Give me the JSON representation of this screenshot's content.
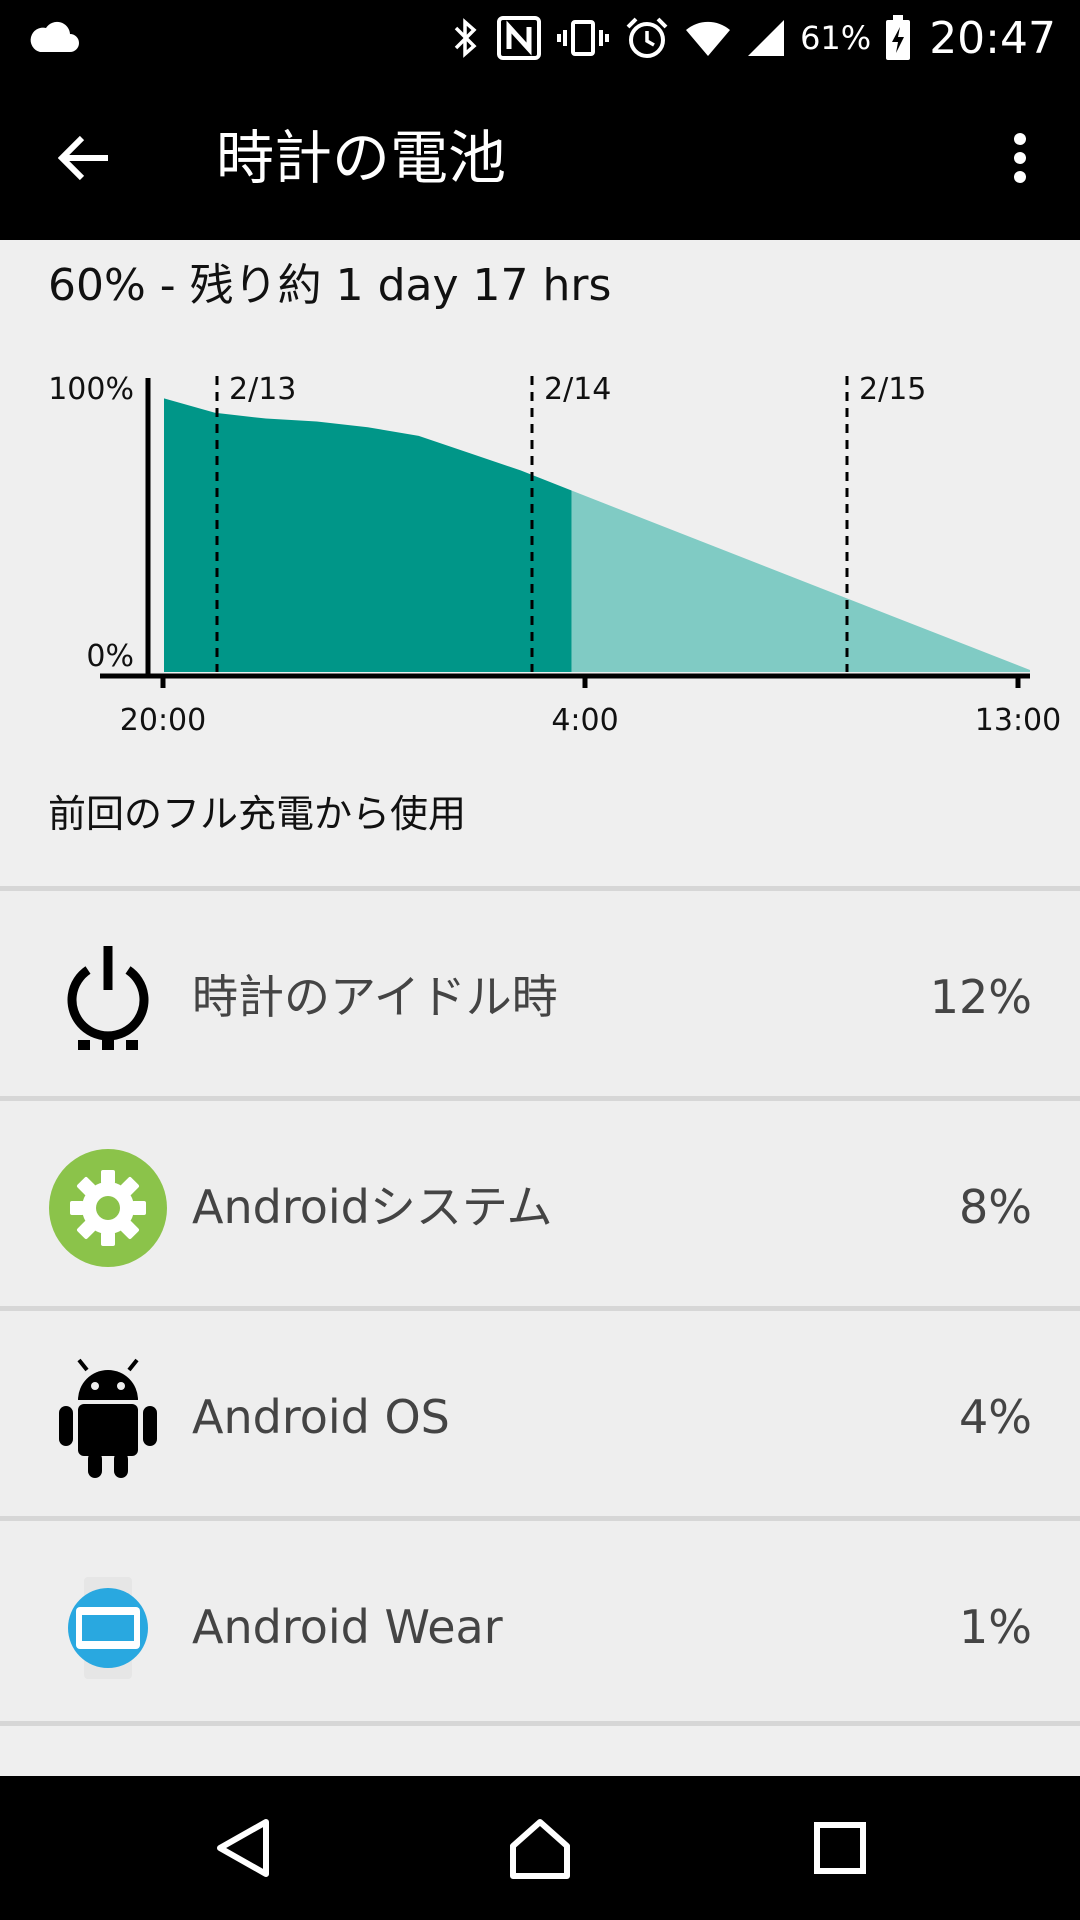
{
  "status_bar": {
    "left_icon": "cloud-icon",
    "icons": [
      "bluetooth-icon",
      "nfc-icon",
      "vibrate-icon",
      "alarm-icon",
      "wifi-icon",
      "signal-icon"
    ],
    "battery_percent": "61%",
    "battery_icon": "battery-charging-icon",
    "time": "20:47"
  },
  "app_bar": {
    "back_icon": "arrow-back-icon",
    "title": "時計の電池",
    "more_icon": "more-vert-icon"
  },
  "summary": "60% - 残り約 1 day 17 hrs",
  "chart_data": {
    "type": "area",
    "y_labels": [
      "100%",
      "0%"
    ],
    "x_tick_labels": [
      "20:00",
      "4:00",
      "13:00"
    ],
    "date_markers": [
      "2/13",
      "2/14",
      "2/15"
    ],
    "colors": {
      "actual": "#009688",
      "predicted": "#80cbc4",
      "axis": "#000000"
    },
    "ylim": [
      0,
      100
    ],
    "series": [
      {
        "kind": "actual",
        "x": [
          "20:00",
          "21:00",
          "22:00",
          "23:00",
          "0:00",
          "1:00",
          "2:00",
          "3:00",
          "4:00"
        ],
        "values": [
          95,
          90,
          88,
          87,
          85,
          82,
          76,
          70,
          63
        ]
      },
      {
        "kind": "predicted",
        "x": [
          "4:00",
          "13:00"
        ],
        "values": [
          63,
          0
        ]
      }
    ]
  },
  "section_label": "前回のフル充電から使用",
  "usage": [
    {
      "icon": "power-idle-icon",
      "label": "時計のアイドル時",
      "value": "12%"
    },
    {
      "icon": "settings-gear-icon",
      "label": "Androidシステム",
      "value": "8%"
    },
    {
      "icon": "android-robot-icon",
      "label": "Android OS",
      "value": "4%"
    },
    {
      "icon": "android-wear-icon",
      "label": "Android Wear",
      "value": "1%"
    }
  ],
  "nav_bar": {
    "back_icon": "nav-back-icon",
    "home_icon": "nav-home-icon",
    "recents_icon": "nav-recents-icon"
  }
}
